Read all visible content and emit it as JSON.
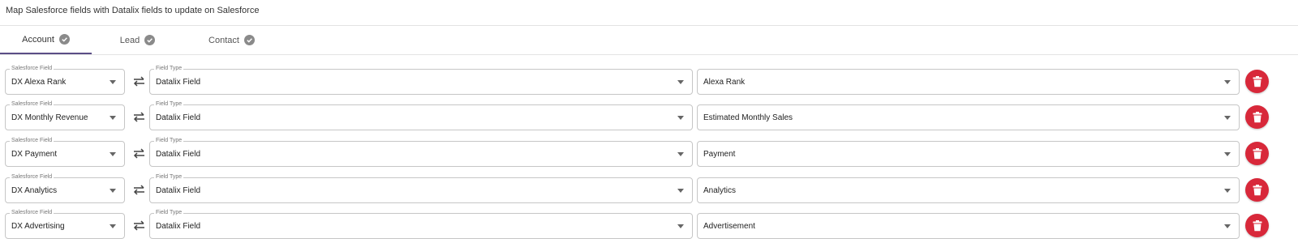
{
  "header": {
    "title": "Map Salesforce fields with Datalix fields to update on Salesforce"
  },
  "tabs": [
    {
      "label": "Account",
      "active": true,
      "icon": "check-circle-icon"
    },
    {
      "label": "Lead",
      "active": false,
      "icon": "check-circle-icon"
    },
    {
      "label": "Contact",
      "active": false,
      "icon": "check-circle-icon"
    }
  ],
  "colors": {
    "accent": "#5b4e86",
    "delete": "#d8283a",
    "border": "#c6c6c6"
  },
  "rows": [
    {
      "salesforce_label": "Salesforce Field",
      "salesforce_value": "DX Alexa Rank",
      "type_label": "Field Type",
      "type_value": "Datalix Field",
      "datalix_value": "Alexa Rank"
    },
    {
      "salesforce_label": "Salesforce Field",
      "salesforce_value": "DX Monthly Revenue",
      "type_label": "Field Type",
      "type_value": "Datalix Field",
      "datalix_value": "Estimated Monthly Sales"
    },
    {
      "salesforce_label": "Salesforce Field",
      "salesforce_value": "DX Payment",
      "type_label": "Field Type",
      "type_value": "Datalix Field",
      "datalix_value": "Payment"
    },
    {
      "salesforce_label": "Salesforce Field",
      "salesforce_value": "DX Analytics",
      "type_label": "Field Type",
      "type_value": "Datalix Field",
      "datalix_value": "Analytics"
    },
    {
      "salesforce_label": "Salesforce Field",
      "salesforce_value": "DX Advertising",
      "type_label": "Field Type",
      "type_value": "Datalix Field",
      "datalix_value": "Advertisement"
    }
  ]
}
